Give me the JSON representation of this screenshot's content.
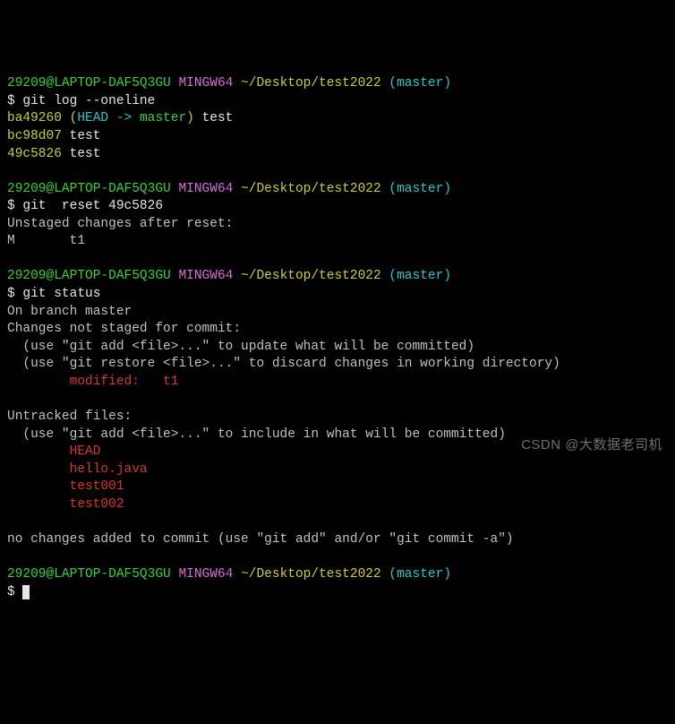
{
  "prompt": {
    "user_host": "29209@LAPTOP-DAF5Q3GU",
    "env": "MINGW64",
    "path": "~/Desktop/test2022",
    "branch": "(master)",
    "symbol": "$"
  },
  "cmd1": "git log --oneline",
  "log": {
    "l1_hash": "ba49260",
    "l1_open": " (",
    "l1_head": "HEAD -> ",
    "l1_master": "master",
    "l1_close": ")",
    "l1_msg": " test",
    "l2_hash": "bc98d07",
    "l2_msg": " test",
    "l3_hash": "49c5826",
    "l3_msg": " test"
  },
  "cmd2": "git  reset 49c5826",
  "reset": {
    "l1": "Unstaged changes after reset:",
    "l2": "M       t1"
  },
  "cmd3": "git status",
  "status": {
    "l1": "On branch master",
    "l2": "Changes not staged for commit:",
    "l3": "  (use \"git add <file>...\" to update what will be committed)",
    "l4": "  (use \"git restore <file>...\" to discard changes in working directory)",
    "l5": "        modified:   t1",
    "l6": "",
    "l7": "Untracked files:",
    "l8": "  (use \"git add <file>...\" to include in what will be committed)",
    "l9": "        HEAD",
    "l10": "        hello.java",
    "l11": "        test001",
    "l12": "        test002",
    "l13": "",
    "l14": "no changes added to commit (use \"git add\" and/or \"git commit -a\")"
  },
  "watermark": "CSDN @大数据老司机"
}
